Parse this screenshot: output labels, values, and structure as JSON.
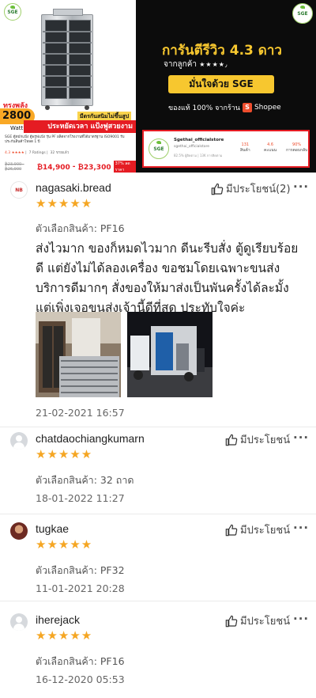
{
  "banner": {
    "logo_left": "SGE",
    "logo_right": "SGE",
    "power_label": "ทรงพลัง",
    "power_value": "2800",
    "power_unit": "Watt",
    "slogan_gold": "มีดรกันสนิมไม่ขึ้นสูป",
    "slogan_red": "ประหยัดเวลา แป้งฟูสวยงาม",
    "guarantee": "การันตีรีวิว 4.3 ดาว",
    "from_buyers": "จากลูกค้า",
    "from_buyers_stars": "★★★★٫",
    "confident": "มั่นใจด้วย SGE",
    "genuine": "ของแท้ 100% จากร้าน",
    "shopee": "Shopee"
  },
  "product": {
    "title": "SGE ตู้หมักแป้ง ตู้พรูฟแป้ง รุ่น PF ผลิตจากโรงงานที่ได้มาตรฐาน ISO9001 รับประกันสินค้าโหลด 1 ปี",
    "rating": "4.3",
    "ratings_count": "7 Ratings",
    "sold": "32 ขายแล้ว",
    "old_price": "₿23,900 - ₿26,900",
    "price_low": "₿14,900",
    "price_sep": "-",
    "price_high": "₿23,300",
    "discount": "37% ลดราคา"
  },
  "store": {
    "name": "Sgethai_officialstore",
    "handle": "sgethai_officialstore",
    "info": "82.5% ผู้ติดตาม | 13K การติดตาม",
    "products": "131",
    "products_label": "สินค้า",
    "rating": "4.6",
    "rating_label": "คะแนน",
    "chat": "90%",
    "chat_label": "การตอบกลับ"
  },
  "reviews": [
    {
      "username": "nagasaki.bread",
      "avatar": "brand",
      "avatar_text": "NB",
      "stars": "★★★★★",
      "helpful_label": "มีประโยชน์(2)",
      "variation": "ตัวเลือกสินค้า: PF16",
      "text": "ส่งไวมาก ของก็หมดไวมาก ดีนะรีบสั่ง ตู้ดูเรียบร้อยดี แต่ยังไม่ได้ลองเครื่อง ขอชมโดยเฉพาะขนส่งบริการดีมากๆ สั่งของให้มาส่งเป็นพันครั้งได้ละมั้ง แต่เพิ่งเจอขนส่งเจ้านี้ดีที่สุด ประทับใจค่ะ",
      "date": "21-02-2021 16:57"
    },
    {
      "username": "chatdaochiangkumarn",
      "avatar": "default",
      "stars": "★★★★★",
      "helpful_label": "มีประโยชน์",
      "variation": "ตัวเลือกสินค้า: 32 ถาด",
      "date": "18-01-2022 11:27"
    },
    {
      "username": "tugkae",
      "avatar": "photo",
      "stars": "★★★★★",
      "helpful_label": "มีประโยชน์",
      "variation": "ตัวเลือกสินค้า: PF32",
      "date": "11-01-2021 20:28"
    },
    {
      "username": "iherejack",
      "avatar": "default",
      "stars": "★★★★★",
      "helpful_label": "มีประโยชน์",
      "variation": "ตัวเลือกสินค้า: PF16",
      "date": "16-12-2020 05:53"
    }
  ],
  "more_label": "···"
}
